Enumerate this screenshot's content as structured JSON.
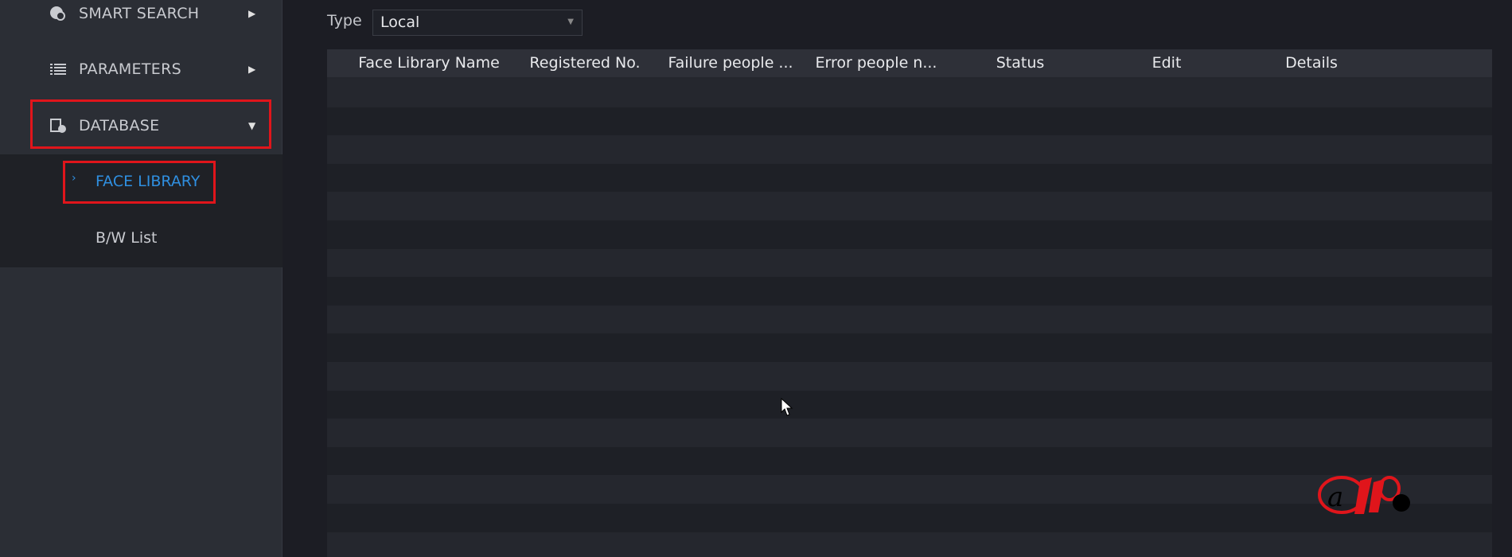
{
  "sidebar": {
    "items": [
      {
        "label": "SMART SEARCH",
        "icon": "smart-search-icon"
      },
      {
        "label": "PARAMETERS",
        "icon": "list-icon"
      },
      {
        "label": "DATABASE",
        "icon": "database-icon",
        "expanded": true
      }
    ],
    "subitems": [
      {
        "label": "FACE LIBRARY",
        "active": true
      },
      {
        "label": "B/W List"
      }
    ]
  },
  "filter": {
    "type_label": "Type",
    "type_value": "Local"
  },
  "table": {
    "columns": [
      "Face Library Name",
      "Registered No.",
      "Failure people ...",
      "Error people n...",
      "Status",
      "Edit",
      "Details"
    ],
    "rows": []
  },
  "colors": {
    "accent": "#2f8fe0",
    "highlight_box": "#e0151b"
  },
  "watermark": "aip"
}
